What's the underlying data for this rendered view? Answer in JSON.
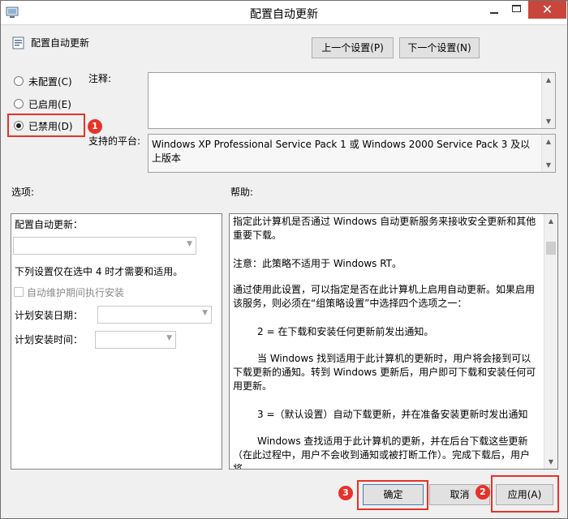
{
  "window": {
    "title": "配置自动更新",
    "close_glyph": "✕"
  },
  "header": {
    "policy_name": "配置自动更新",
    "prev_button": "上一个设置(P)",
    "next_button": "下一个设置(N)"
  },
  "state": {
    "options": [
      {
        "label": "未配置(C)",
        "checked": false
      },
      {
        "label": "已启用(E)",
        "checked": false
      },
      {
        "label": "已禁用(D)",
        "checked": true
      }
    ],
    "comment_label": "注释:",
    "comment_value": "",
    "platform_label": "支持的平台:",
    "platform_value": "Windows XP Professional Service Pack 1 或 Windows 2000 Service Pack 3 及以上版本"
  },
  "options_section": {
    "heading": "选项:",
    "auto_update_label": "配置自动更新：",
    "auto_update_value": "",
    "note": "下列设置仅在选中 4 时才需要和适用。",
    "maintenance_checkbox": "自动维护期间执行安装",
    "install_day_label": "计划安装日期：",
    "install_day_value": "",
    "install_time_label": "计划安装时间：",
    "install_time_value": ""
  },
  "help_section": {
    "heading": "帮助:",
    "paragraphs": [
      "指定此计算机是否通过 Windows 自动更新服务来接收安全更新和其他重要下载。",
      "注意：此策略不适用于 Windows RT。",
      "通过使用此设置，可以指定是否在此计算机上启用自动更新。如果启用该服务，则必须在“组策略设置”中选择四个选项之一：",
      "2 = 在下载和安装任何更新前发出通知。",
      "当 Windows 找到适用于此计算机的更新时，用户将会接到可以下载更新的通知。转到 Windows 更新后，用户即可下载和安装任何可用更新。",
      "3 =（默认设置）自动下载更新，并在准备安装更新时发出通知",
      "Windows 查找适用于此计算机的更新，并在后台下载这些更新（在此过程中，用户不会收到通知或被打断工作）。完成下载后，用户将"
    ]
  },
  "footer": {
    "ok": "确定",
    "cancel": "取消",
    "apply": "应用(A)"
  },
  "annotations": {
    "badge_1": "1",
    "badge_2": "2",
    "badge_3": "3",
    "highlight_color": "#e5332a"
  }
}
